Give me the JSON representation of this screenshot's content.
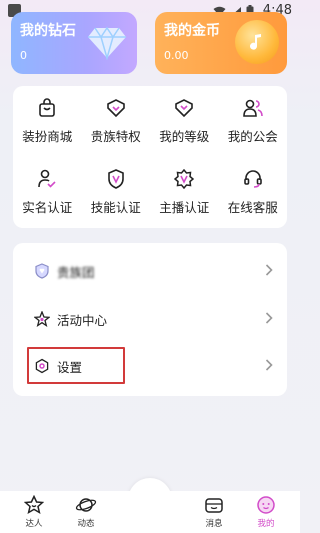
{
  "status_bar": {
    "time": "4:48"
  },
  "wallet": {
    "diamond": {
      "title": "我的钻石",
      "value": "0"
    },
    "gold": {
      "title": "我的金币",
      "value": "0.00"
    }
  },
  "grid": [
    {
      "label": "装扮商城",
      "icon": "shopping-bag-icon"
    },
    {
      "label": "贵族特权",
      "icon": "crown-heart-icon"
    },
    {
      "label": "我的等级",
      "icon": "heart-level-icon"
    },
    {
      "label": "我的公会",
      "icon": "people-icon"
    },
    {
      "label": "实名认证",
      "icon": "user-verify-icon"
    },
    {
      "label": "技能认证",
      "icon": "shield-v-icon"
    },
    {
      "label": "主播认证",
      "icon": "star-badge-icon"
    },
    {
      "label": "在线客服",
      "icon": "headset-icon"
    }
  ],
  "list": [
    {
      "label": "贵族团",
      "icon": "heart-shield-icon"
    },
    {
      "label": "活动中心",
      "icon": "star-icon"
    },
    {
      "label": "设置",
      "icon": "hexagon-gear-icon"
    }
  ],
  "nav": [
    {
      "label": "达人",
      "icon": "star-face-icon"
    },
    {
      "label": "动态",
      "icon": "planet-icon"
    },
    {
      "label": "",
      "icon": "room-icon"
    },
    {
      "label": "消息",
      "icon": "message-box-icon"
    },
    {
      "label": "我的",
      "icon": "profile-face-icon"
    }
  ],
  "colors": {
    "accent": "#d24cc9",
    "highlight": "#d23a3a"
  }
}
